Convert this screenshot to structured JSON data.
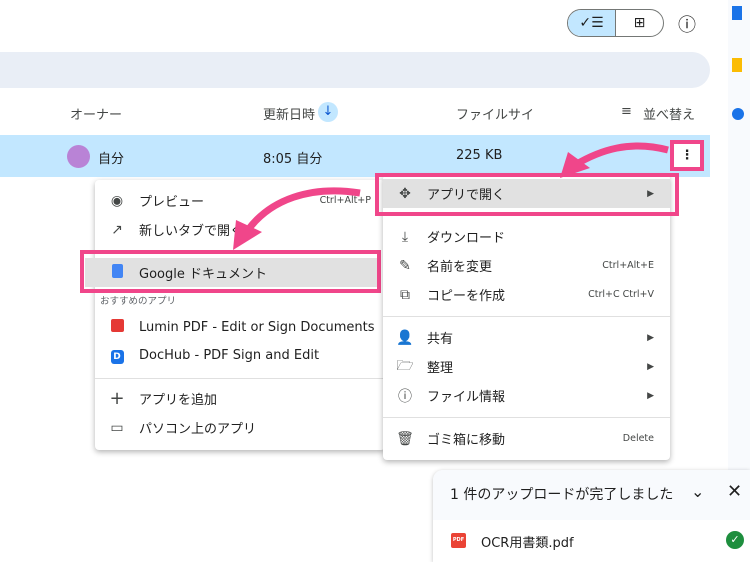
{
  "toolbar": {
    "list_view": "✓☰",
    "grid_view": "⊞",
    "info_icon": "ⓘ"
  },
  "columns": {
    "owner": "オーナー",
    "modified": "更新日時",
    "size": "ファイルサイ",
    "sort": "並べ替え"
  },
  "file_row": {
    "owner": "自分",
    "modified": "8:05 自分",
    "size": "225 KB"
  },
  "open_with_menu": {
    "items": [
      {
        "label": "プレビュー",
        "shortcut": "Ctrl+Alt+P"
      },
      {
        "label": "新しいタブで開く"
      },
      {
        "label": "Google ドキュメント"
      }
    ],
    "suggested_heading": "おすすめのアプリ",
    "suggested": [
      {
        "label": "Lumin PDF - Edit or Sign Documents"
      },
      {
        "label": "DocHub - PDF Sign and Edit"
      }
    ],
    "footer": [
      {
        "label": "アプリを追加"
      },
      {
        "label": "パソコン上のアプリ"
      }
    ]
  },
  "context_menu": {
    "open_with": "アプリで開く",
    "download": "ダウンロード",
    "rename": {
      "label": "名前を変更",
      "shortcut": "Ctrl+Alt+E"
    },
    "copy": {
      "label": "コピーを作成",
      "shortcut": "Ctrl+C Ctrl+V"
    },
    "share": "共有",
    "organize": "整理",
    "file_info": "ファイル情報",
    "trash": {
      "label": "ゴミ箱に移動",
      "shortcut": "Delete"
    }
  },
  "upload_panel": {
    "title": "1 件のアップロードが完了しました",
    "file": "OCR用書類.pdf",
    "file_badge": "PDF"
  },
  "colors": {
    "highlight": "#f0468a",
    "selected_row": "#c2e7ff"
  }
}
